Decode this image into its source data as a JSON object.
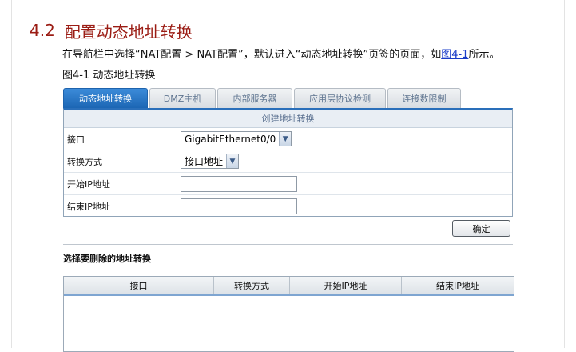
{
  "section": {
    "number": "4.2",
    "title": "配置动态地址转换"
  },
  "intro": {
    "before": "在导航栏中选择“NAT配置 > NAT配置”，默认进入“动态地址转换”页签的页面，如",
    "link": "图4-1",
    "after": "所示。"
  },
  "figure": {
    "caption": "图4-1 动态地址转换"
  },
  "tabs": [
    {
      "label": "动态地址转换",
      "active": true
    },
    {
      "label": "DMZ主机",
      "active": false
    },
    {
      "label": "内部服务器",
      "active": false
    },
    {
      "label": "应用层协议检测",
      "active": false
    },
    {
      "label": "连接数限制",
      "active": false
    }
  ],
  "form": {
    "header": "创建地址转换",
    "fields": [
      {
        "label": "接口",
        "value": "GigabitEthernet0/0"
      },
      {
        "label": "转换方式",
        "value": "接口地址"
      },
      {
        "label": "开始IP地址",
        "value": ""
      },
      {
        "label": "结束IP地址",
        "value": ""
      }
    ]
  },
  "ok_button": "确定",
  "delete_section": {
    "title": "选择要删除的地址转换",
    "columns": [
      "接口",
      "转换方式",
      "开始IP地址",
      "结束IP地址"
    ]
  },
  "colors": {
    "heading": "#9b1c14",
    "tab_active": "#2a6fba",
    "link": "#1a3cc8"
  }
}
